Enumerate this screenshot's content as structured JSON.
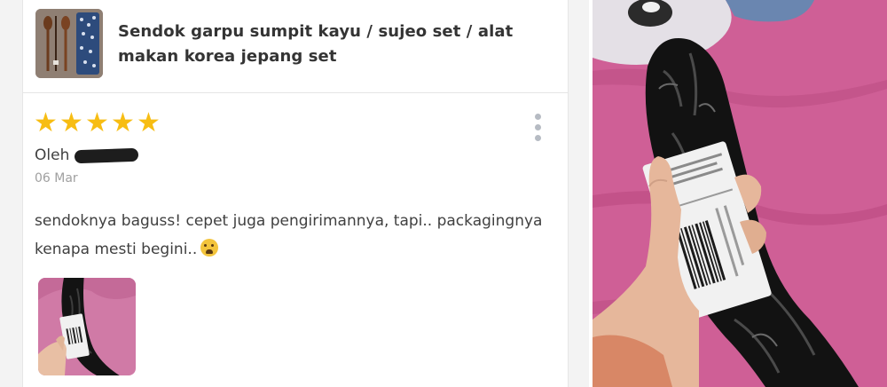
{
  "product": {
    "title": "Sendok garpu sumpit kayu / sujeo set / alat makan korea jepang set",
    "thumbnail_icon": "chopsticks-spoon-set-thumbnail"
  },
  "review": {
    "rating": 5,
    "rating_max": 5,
    "stars": [
      "★",
      "★",
      "★",
      "★",
      "★"
    ],
    "author_prefix": "Oleh",
    "date": "06 Mar",
    "text": "sendoknya baguss! cepet juga pengirimannya, tapi.. packagingnya kenapa mesti begini..",
    "emoji_icon": "crying-face-emoji",
    "menu_icon": "kebab-menu-icon"
  },
  "colors": {
    "star": "#f7bd13",
    "title": "#343434",
    "text": "#404040",
    "date": "#a0a0a0",
    "background_pink": "#cc5e93"
  }
}
